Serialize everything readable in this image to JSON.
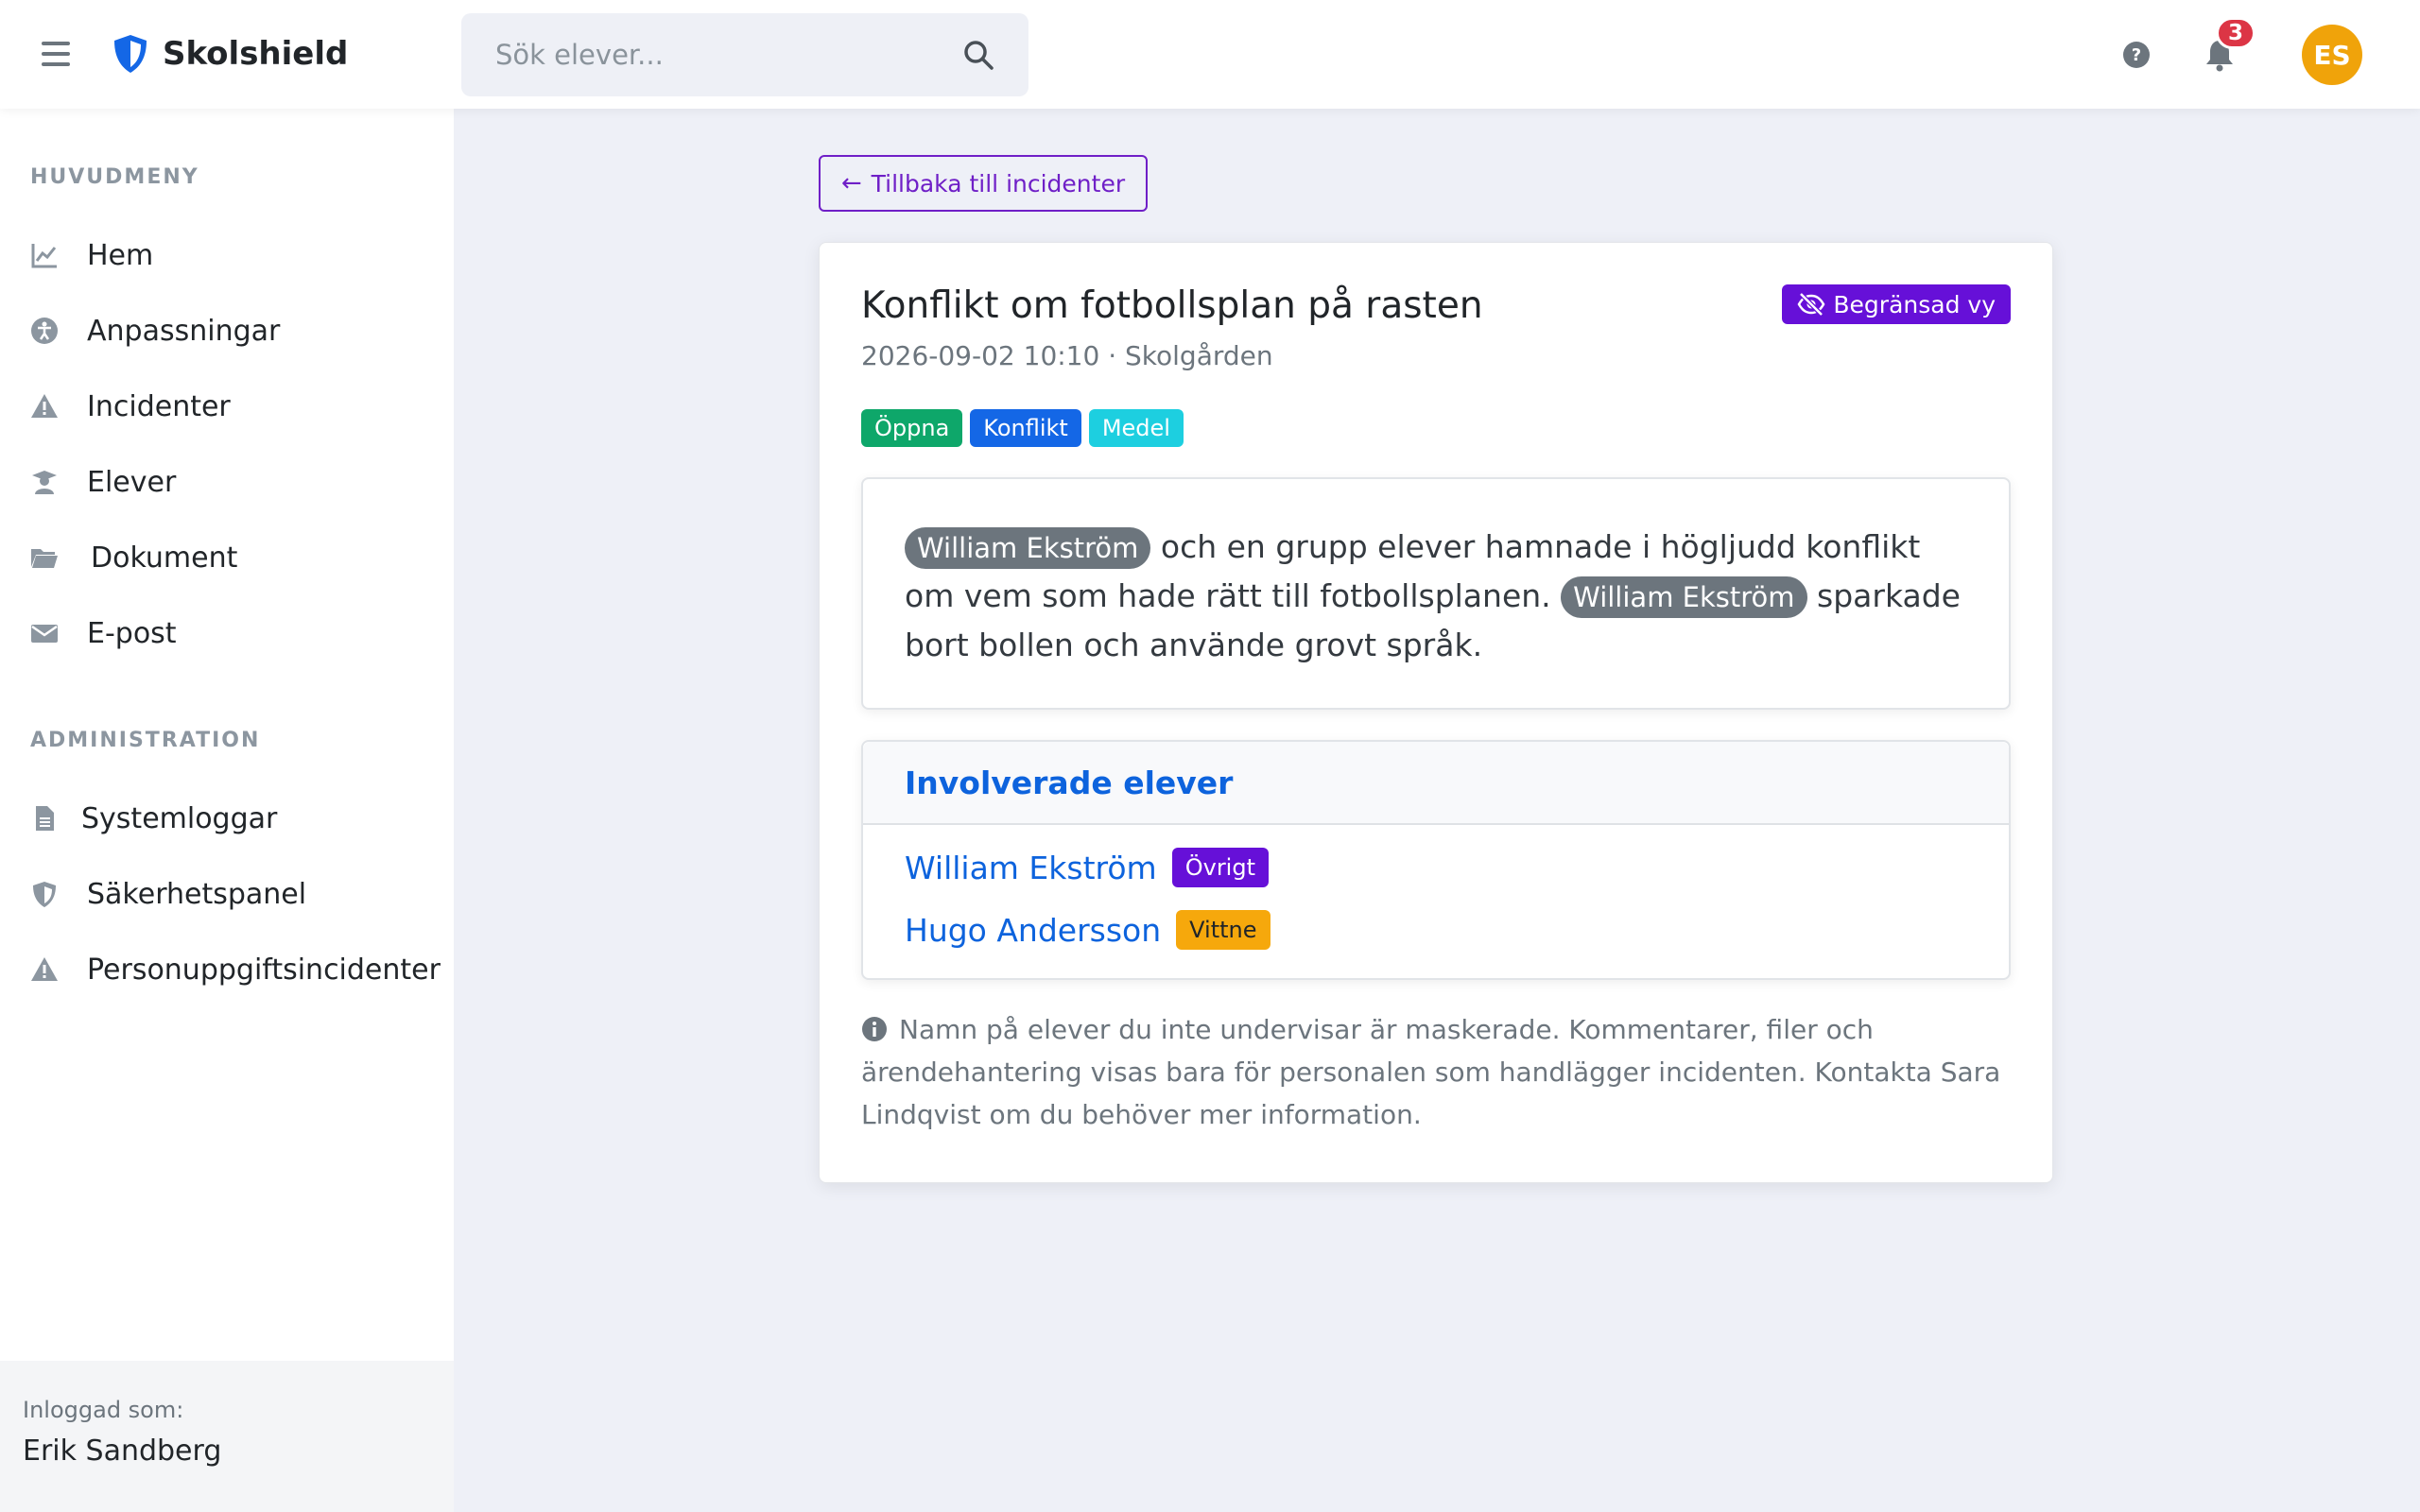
{
  "app": {
    "name": "Skolshield"
  },
  "search": {
    "placeholder": "Sök elever..."
  },
  "header": {
    "notification_count": "3",
    "avatar_initials": "ES"
  },
  "sidebar": {
    "main_heading": "HUVUDMENY",
    "main_items": [
      {
        "label": "Hem",
        "icon": "chart-line-icon"
      },
      {
        "label": "Anpassningar",
        "icon": "accessibility-icon"
      },
      {
        "label": "Incidenter",
        "icon": "warning-icon"
      },
      {
        "label": "Elever",
        "icon": "student-icon"
      },
      {
        "label": "Dokument",
        "icon": "folder-icon"
      },
      {
        "label": "E-post",
        "icon": "envelope-icon"
      }
    ],
    "admin_heading": "ADMINISTRATION",
    "admin_items": [
      {
        "label": "Systemloggar",
        "icon": "file-icon"
      },
      {
        "label": "Säkerhetspanel",
        "icon": "shield-icon"
      },
      {
        "label": "Personuppgiftsincidenter",
        "icon": "warning-icon"
      }
    ],
    "logged_in_label": "Inloggad som:",
    "logged_in_user": "Erik Sandberg"
  },
  "back_button": {
    "label": "Tillbaka till incidenter"
  },
  "incident": {
    "title": "Konflikt om fotbollsplan på rasten",
    "meta": "2026-09-02 10:10 · Skolgården",
    "restricted_label": "Begränsad vy",
    "tags": [
      "Öppna",
      "Konflikt",
      "Medel"
    ],
    "description": {
      "masked_name": "William Ekström",
      "part1": " och en grupp elever hamnade i högljudd konflikt om vem som hade rätt till fotbollsplanen. ",
      "part2": " sparkade bort bollen och använde grovt språk."
    },
    "students_heading": "Involverade elever",
    "students": [
      {
        "name": "William Ekström",
        "role": "Övrigt"
      },
      {
        "name": "Hugo Andersson",
        "role": "Vittne"
      }
    ],
    "note": "Namn på elever du inte undervisar är maskerade. Kommentarer, filer och ärendehantering visas bara för personalen som handlägger incidenten. Kontakta Sara Lindqvist om du behöver mer information."
  },
  "colors": {
    "brand_blue": "#1467e6",
    "accent_purple": "#6610d8",
    "status_green": "#0ea76a",
    "status_cyan": "#1dcfe0",
    "role_yellow": "#f6a80c",
    "badge_red": "#dc3545",
    "avatar_orange": "#f0a30a"
  }
}
